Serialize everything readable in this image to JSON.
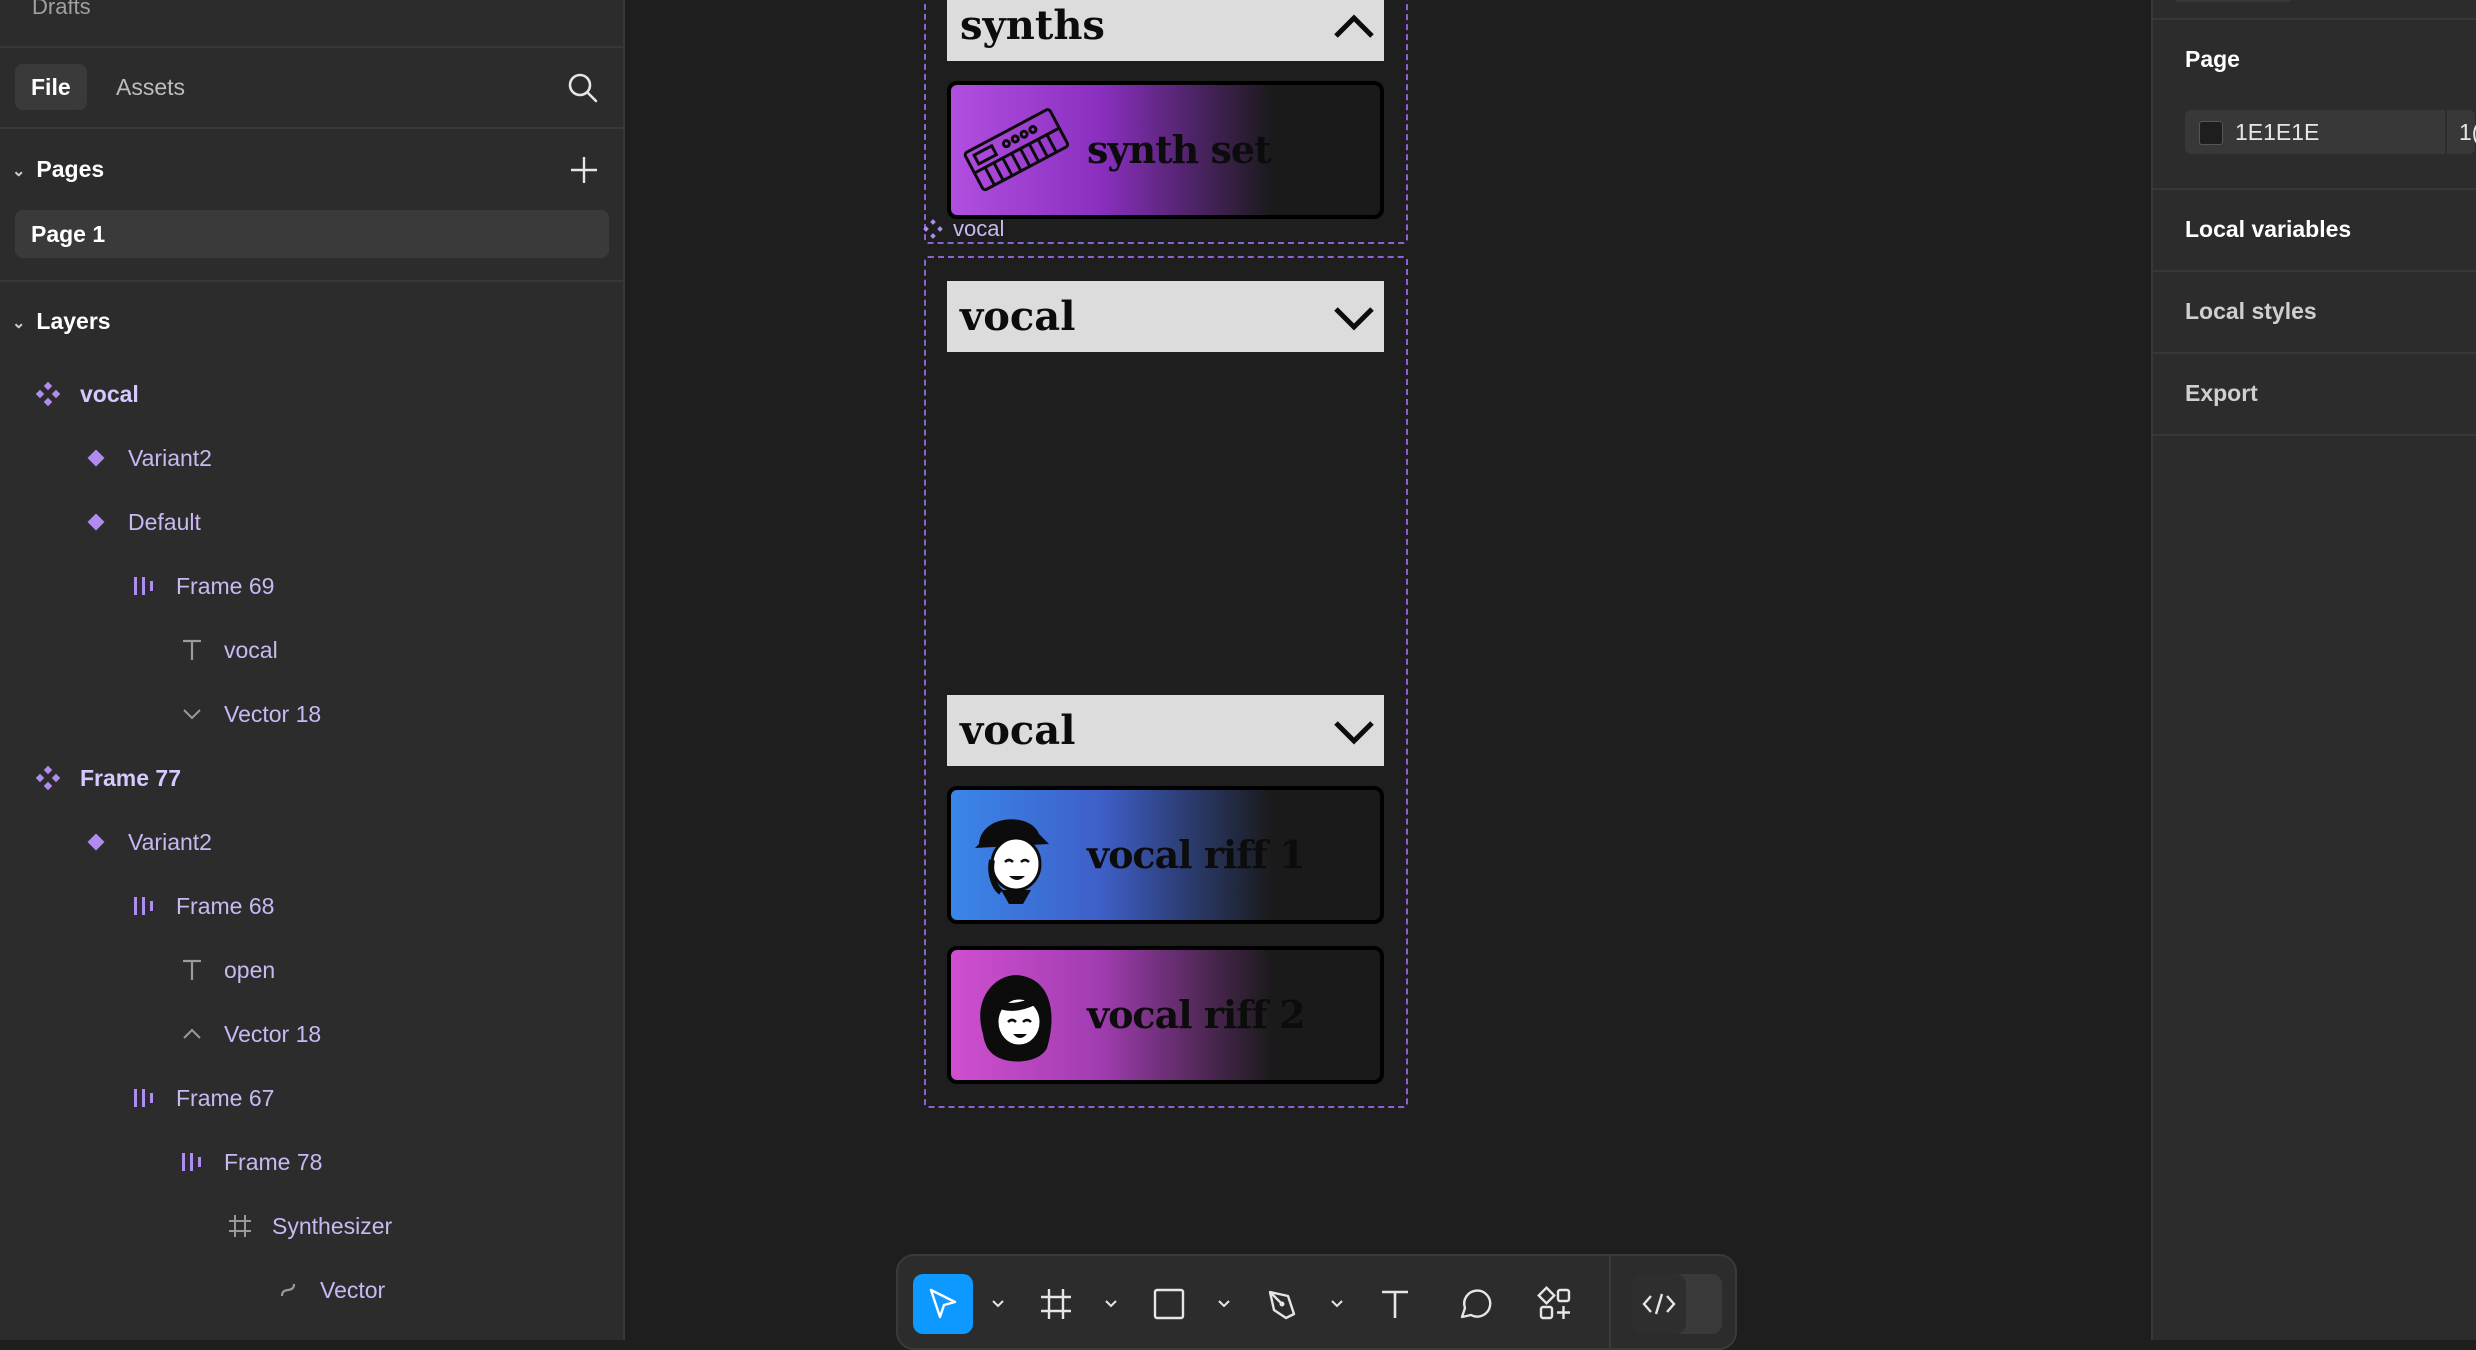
{
  "sidebar": {
    "drafts": "Drafts",
    "tabs": {
      "file": "File",
      "assets": "Assets"
    },
    "pages_title": "Pages",
    "pages": [
      "Page 1"
    ],
    "layers_title": "Layers",
    "layers": [
      {
        "name": "vocal",
        "icon": "component-set-icon"
      },
      {
        "name": "Variant2",
        "icon": "variant-icon"
      },
      {
        "name": "Default",
        "icon": "variant-icon"
      },
      {
        "name": "Frame 69",
        "icon": "auto-layout-icon"
      },
      {
        "name": "vocal",
        "icon": "text-icon"
      },
      {
        "name": "Vector 18",
        "icon": "vector-chevron-down-icon"
      },
      {
        "name": "Frame 77",
        "icon": "component-set-icon"
      },
      {
        "name": "Variant2",
        "icon": "variant-icon"
      },
      {
        "name": "Frame 68",
        "icon": "auto-layout-icon"
      },
      {
        "name": "open",
        "icon": "text-icon"
      },
      {
        "name": "Vector 18",
        "icon": "vector-chevron-up-icon"
      },
      {
        "name": "Frame 67",
        "icon": "auto-layout-icon"
      },
      {
        "name": "Frame 78",
        "icon": "auto-layout-icon"
      },
      {
        "name": "Synthesizer",
        "icon": "frame-icon"
      },
      {
        "name": "Vector",
        "icon": "vector-icon"
      }
    ]
  },
  "canvas": {
    "component_label": "vocal",
    "dropdowns": [
      "synths",
      "vocal",
      "vocal"
    ],
    "cards": [
      {
        "title": "synth set",
        "gradient_start": "#b14fe0"
      },
      {
        "title": "vocal riff 1",
        "gradient_start": "#3a86e8"
      },
      {
        "title": "vocal riff 2",
        "gradient_start": "#d04fd0"
      }
    ]
  },
  "right_panel": {
    "page_title": "Page",
    "background_hex": "1E1E1E",
    "opacity_partial": "1(",
    "local_variables": "Local variables",
    "local_styles": "Local styles",
    "export": "Export"
  },
  "colors": {
    "accent": "#0d99ff",
    "component_purple": "#8a63d2",
    "canvas_bg": "#1e1e1e"
  }
}
